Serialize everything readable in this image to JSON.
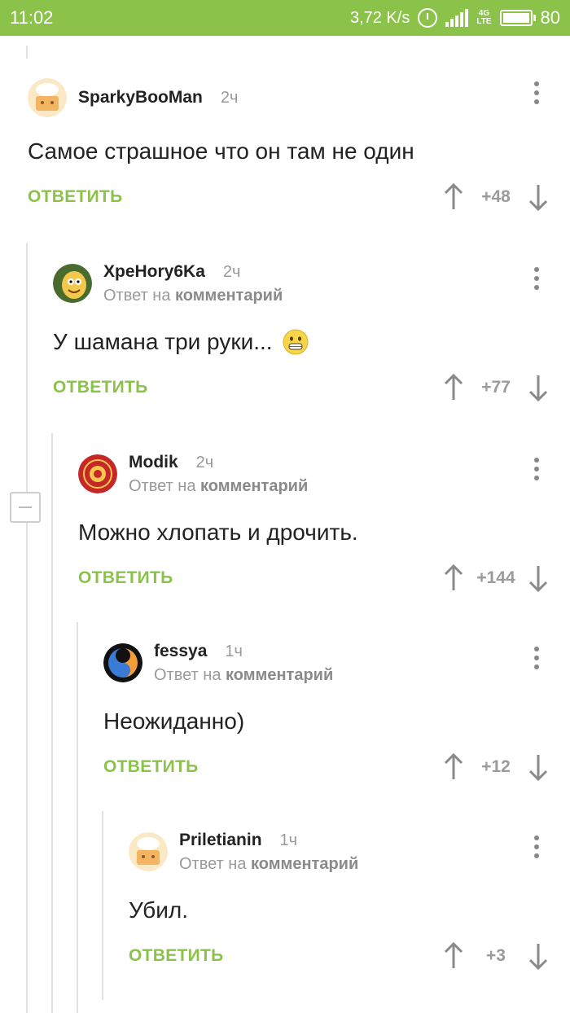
{
  "status_bar": {
    "time": "11:02",
    "speed": "3,72 K/s",
    "network": "4G",
    "network_sub": "LTE",
    "battery": "80",
    "accent": "#8bc34a"
  },
  "comments": [
    {
      "user": "SparkyBooMan",
      "time": "2ч",
      "reply_prefix": "",
      "reply_target": "",
      "text": "Самое страшное что он там не один",
      "reply_button": "ОТВЕТИТЬ",
      "score": "+48",
      "avatar": "chef-hat-avatar"
    },
    {
      "user": "XpeHory6Ka",
      "time": "2ч",
      "reply_prefix": "Ответ на",
      "reply_target": "комментарий",
      "text": "У шамана три руки...",
      "emoji": "grinning-face-icon",
      "reply_button": "ОТВЕТИТЬ",
      "score": "+77",
      "avatar": "cartoon-character-avatar"
    },
    {
      "user": "Modik",
      "time": "2ч",
      "reply_prefix": "Ответ на",
      "reply_target": "комментарий",
      "text": "Можно хлопать и дрочить.",
      "reply_button": "ОТВЕТИТЬ",
      "score": "+144",
      "avatar": "red-emblem-avatar"
    },
    {
      "user": "fessya",
      "time": "1ч",
      "reply_prefix": "Ответ на",
      "reply_target": "комментарий",
      "text": "Неожиданно)",
      "reply_button": "ОТВЕТИТЬ",
      "score": "+12",
      "avatar": "fire-ice-avatar"
    },
    {
      "user": "Priletianin",
      "time": "1ч",
      "reply_prefix": "Ответ на",
      "reply_target": "комментарий",
      "text": "Убил.",
      "reply_button": "ОТВЕТИТЬ",
      "score": "+3",
      "avatar": "chef-hat-avatar"
    }
  ]
}
